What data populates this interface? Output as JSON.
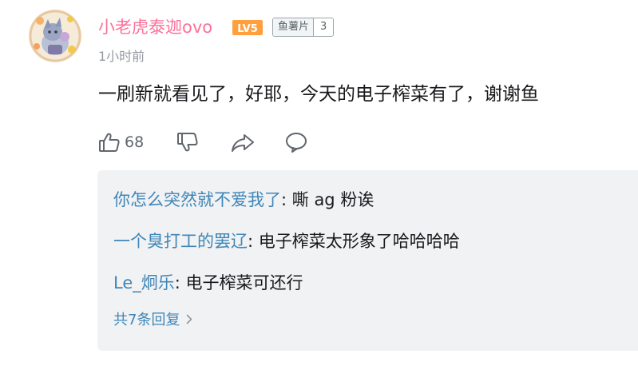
{
  "comment": {
    "username": "小老虎泰迦ovo",
    "level_badge": "LV5",
    "fan_badge": {
      "name": "鱼薯片",
      "level": "3"
    },
    "time": "1小时前",
    "content": "一刷新就看见了，好耶，今天的电子榨菜有了，谢谢鱼",
    "like_count": "68",
    "icons": [
      "thumbs-up-icon",
      "thumbs-down-icon",
      "share-icon",
      "reply-bubble-icon"
    ]
  },
  "replies": [
    {
      "user": "你怎么突然就不爱我了",
      "sep": ": ",
      "text": "嘶 ag 粉诶"
    },
    {
      "user": "一个臭打工的罢辽",
      "sep": ": ",
      "text": "电子榨菜太形象了哈哈哈哈"
    },
    {
      "user": "Le_炯乐",
      "sep": ": ",
      "text": "电子榨菜可还行"
    }
  ],
  "more_replies_label": "共7条回复",
  "colors": {
    "username": "#fb7299",
    "reply_user": "#3f86b8",
    "level_badge": "#ff9f3d",
    "replies_bg": "#f1f2f3",
    "secondary_text": "#9499a0"
  }
}
